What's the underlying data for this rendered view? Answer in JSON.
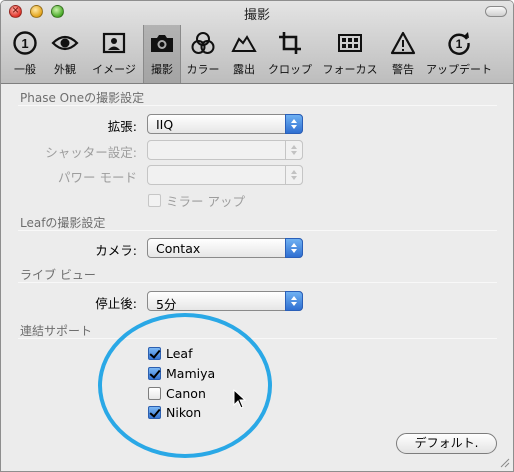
{
  "window": {
    "title": "撮影"
  },
  "toolbar": {
    "tabs": [
      {
        "label": "一般",
        "icon": "general-icon"
      },
      {
        "label": "外観",
        "icon": "eye-icon"
      },
      {
        "label": "イメージ",
        "icon": "image-icon"
      },
      {
        "label": "撮影",
        "icon": "camera-icon",
        "active": true
      },
      {
        "label": "カラー",
        "icon": "color-icon"
      },
      {
        "label": "露出",
        "icon": "exposure-icon"
      },
      {
        "label": "クロップ",
        "icon": "crop-icon"
      },
      {
        "label": "フォーカス",
        "icon": "focus-icon"
      },
      {
        "label": "警告",
        "icon": "warning-icon"
      },
      {
        "label": "アップデート",
        "icon": "update-icon"
      }
    ]
  },
  "phase_one": {
    "title": "Phase Oneの撮影設定",
    "extension_label": "拡張:",
    "extension_value": "IIQ",
    "shutter_label": "シャッター設定:",
    "shutter_value": "",
    "power_label": "パワー モード",
    "power_value": "",
    "mirror_up_label": "ミラー アップ",
    "mirror_up_checked": false
  },
  "leaf": {
    "title": "Leafの撮影設定",
    "camera_label": "カメラ:",
    "camera_value": "Contax"
  },
  "live_view": {
    "title": "ライブ ビュー",
    "stop_label": "停止後:",
    "stop_value": "5分"
  },
  "tethering": {
    "title": "連結サポート",
    "items": [
      {
        "label": "Leaf",
        "checked": true
      },
      {
        "label": "Mamiya",
        "checked": true
      },
      {
        "label": "Canon",
        "checked": false
      },
      {
        "label": "Nikon",
        "checked": true
      }
    ]
  },
  "buttons": {
    "default_label": "デフォルト."
  },
  "colors": {
    "annotation_circle": "#2aa8e6",
    "popup_accent": "#3a7bd8"
  }
}
